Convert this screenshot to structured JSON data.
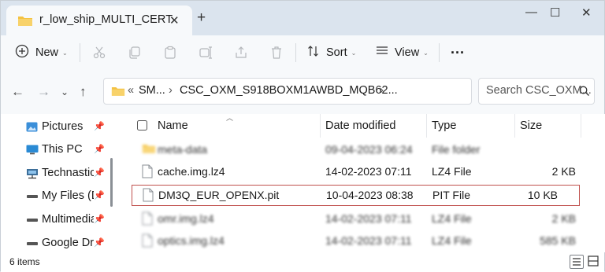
{
  "window": {
    "tab_title": "r_low_ship_MULTI_CERT"
  },
  "toolbar": {
    "new_label": "New",
    "sort_label": "Sort",
    "view_label": "View",
    "more_label": "···"
  },
  "address": {
    "overflow": "«",
    "crumbs": [
      "SM...",
      "CSC_OXM_S918BOXM1AWBD_MQB62..."
    ],
    "separator": "›"
  },
  "search": {
    "placeholder": "Search CSC_OXM..."
  },
  "sidebar": {
    "items": [
      {
        "label": "Pictures",
        "icon": "pictures-icon"
      },
      {
        "label": "This PC",
        "icon": "pc-icon"
      },
      {
        "label": "Technastic",
        "icon": "network-folder-icon"
      },
      {
        "label": "My Files (D:",
        "icon": "drive-icon"
      },
      {
        "label": "Multimedia",
        "icon": "drive-icon"
      },
      {
        "label": "Google Drive",
        "icon": "drive-icon"
      }
    ]
  },
  "columns": {
    "name": "Name",
    "date": "Date modified",
    "type": "Type",
    "size": "Size"
  },
  "files": [
    {
      "name": "meta-data",
      "date": "09-04-2023 06:24",
      "type": "File folder",
      "size": "",
      "kind": "folder",
      "blurred": true
    },
    {
      "name": "cache.img.lz4",
      "date": "14-02-2023 07:11",
      "type": "LZ4 File",
      "size": "2 KB",
      "kind": "file",
      "blurred": false
    },
    {
      "name": "DM3Q_EUR_OPENX.pit",
      "date": "10-04-2023 08:38",
      "type": "PIT File",
      "size": "10 KB",
      "kind": "file",
      "blurred": false,
      "highlighted": true
    },
    {
      "name": "omr.img.lz4",
      "date": "14-02-2023 07:11",
      "type": "LZ4 File",
      "size": "2 KB",
      "kind": "file",
      "blurred": true
    },
    {
      "name": "optics.img.lz4",
      "date": "14-02-2023 07:11",
      "type": "LZ4 File",
      "size": "585 KB",
      "kind": "file",
      "blurred": true
    }
  ],
  "status": {
    "item_count": "6 items"
  },
  "colors": {
    "folder": "#f4c242",
    "highlight": "#c0504d",
    "titlebar": "#dbe4ee"
  }
}
